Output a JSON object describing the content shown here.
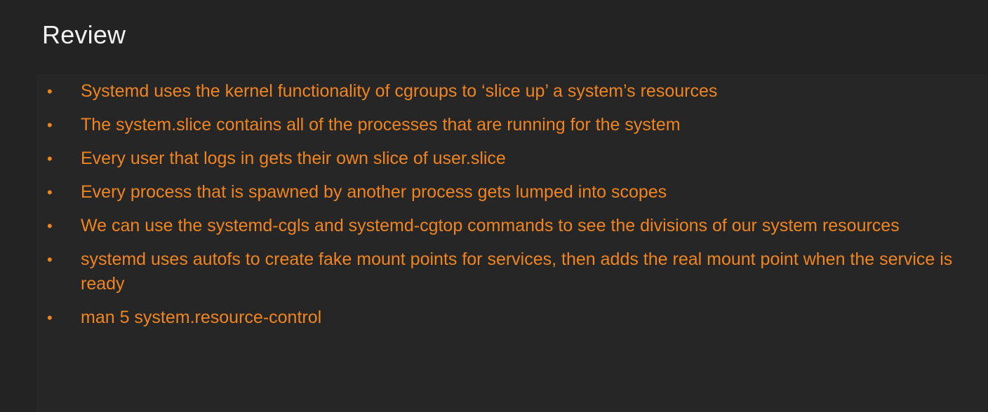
{
  "slide": {
    "title": "Review",
    "colors": {
      "background": "#232323",
      "panel": "#262626",
      "title": "#f2f2f2",
      "accent": "#f0851f"
    },
    "bullet_marker": "•",
    "bullets": [
      "Systemd uses the kernel functionality of cgroups to ‘slice up’ a system’s resources",
      "The system.slice contains all of the processes that are running for the system",
      "Every user that logs in gets their own slice of user.slice",
      "Every process that is spawned by another process gets lumped into scopes",
      "We can use the systemd-cgls and systemd-cgtop commands to see the divisions of our system resources",
      "systemd uses autofs to create fake mount points for services, then adds the real mount point when the service is ready",
      "man 5 system.resource-control"
    ]
  }
}
